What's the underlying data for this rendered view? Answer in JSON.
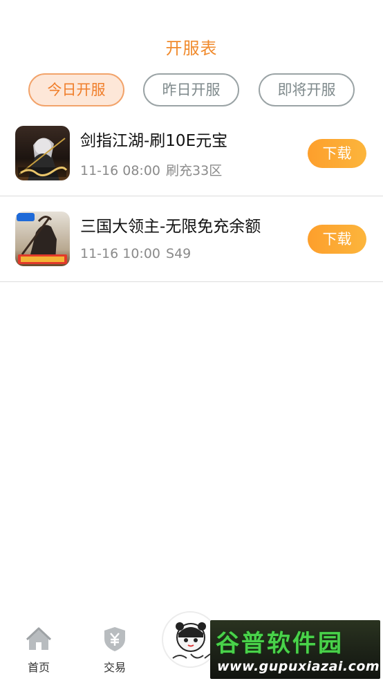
{
  "header": {
    "title": "开服表"
  },
  "tabs": [
    {
      "label": "今日开服",
      "active": true
    },
    {
      "label": "昨日开服",
      "active": false
    },
    {
      "label": "即将开服",
      "active": false
    }
  ],
  "games": [
    {
      "name": "剑指江湖-刷10E元宝",
      "time": "11-16 08:00",
      "server": "刷充33区",
      "action": "下载"
    },
    {
      "name": "三国大领主-无限免充余额",
      "time": "11-16 10:00",
      "server": "S49",
      "action": "下载"
    }
  ],
  "bottom_nav": {
    "home_label": "首页",
    "trade_label": "交易"
  },
  "watermark": {
    "main": "谷普软件园",
    "url": "www.gupuxiazai.com"
  },
  "colors": {
    "accent": "#f08a2c",
    "download_gradient_start": "#fd9f2c",
    "download_gradient_end": "#fcb53c",
    "active_tab_bg": "#fde7d8"
  }
}
